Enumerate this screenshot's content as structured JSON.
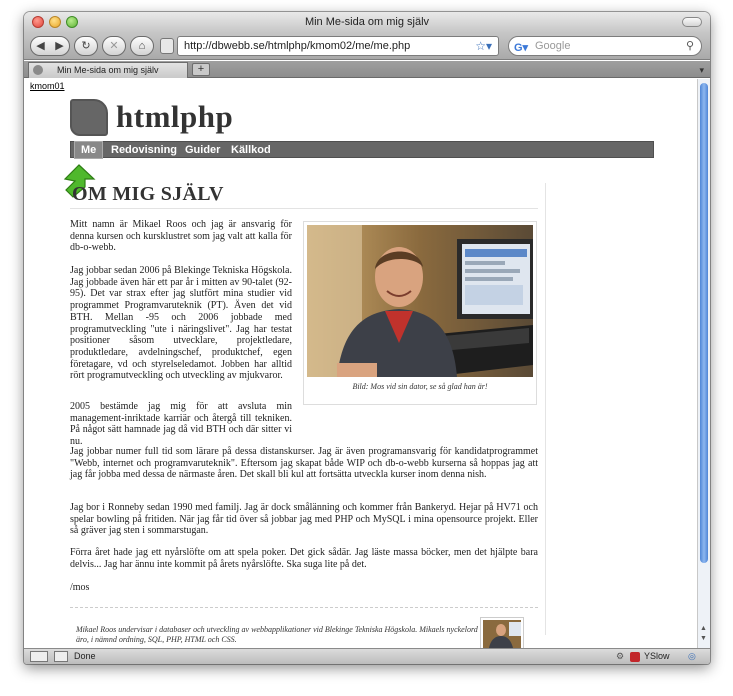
{
  "browser": {
    "window_title": "Min Me-sida om mig själv",
    "url": "http://dbwebb.se/htmlphp/kmom02/me/me.php",
    "search_placeholder": "Google",
    "tab_label": "Min Me-sida om mig själv",
    "new_tab_label": "+",
    "status_text": "Done",
    "yslow_label": "YSlow"
  },
  "page": {
    "kmom_link": "kmom01",
    "site_title": "htmlphp",
    "nav": [
      {
        "label": "Me",
        "selected": true
      },
      {
        "label": "Redovisning",
        "selected": false
      },
      {
        "label": "Guider",
        "selected": false
      },
      {
        "label": "Källkod",
        "selected": false
      }
    ],
    "heading": "OM MIG SJÄLV",
    "paragraphs": [
      "Mitt namn är Mikael Roos och jag är ansvarig för denna kursen och kursklustret som jag valt att kalla för db-o-webb.",
      "Jag jobbar sedan 2006 på Blekinge Tekniska Högskola. Jag jobbade även här ett par år i mitten av 90-talet (92-95). Det var strax efter jag slutfört mina studier vid programmet Programvaruteknik (PT). Även det vid BTH. Mellan -95 och 2006 jobbade med programutveckling \"ute i näringslivet\". Jag har testat positioner såsom utvecklare, projektledare, produktledare, avdelningschef, produktchef, egen företagare, vd och styrelseledamot. Jobben har alltid rört programutveckling och utveckling av mjukvaror.",
      "2005 bestämde jag mig för att avsluta min management-inriktade karriär och återgå till tekniken. På något sätt hamnade jag då vid BTH och där sitter vi nu.",
      "Jag jobbar numer full tid som lärare på dessa distanskurser. Jag är även programansvarig för kandidatprogrammet \"Webb, internet och programvaruteknik\". Eftersom jag skapat både WIP och db-o-webb kurserna så hoppas jag att jag får jobba med dessa de närmaste åren. Det skall bli kul att fortsätta utveckla kurser inom denna nish.",
      "Jag bor i Ronneby sedan 1990 med familj. Jag är dock smålänning och kommer från Bankeryd. Hejar på HV71 och spelar bowling på fritiden. När jag får tid över så jobbar jag med PHP och MySQL i mina opensource projekt. Eller så gräver jag sten i sommarstugan.",
      "Förra året hade jag ett nyårslöfte om att spela poker. Det gick sådär. Jag läste massa böcker, men det hjälpte bara delvis... Jag har ännu inte kommit på årets nyårslöfte. Ska suga lite på det.",
      "/mos"
    ],
    "photo_caption": "Bild: Mos vid sin dator, se så glad han är!",
    "footer": "Mikael Roos undervisar i databaser och utveckling av webbapplikationer vid Blekinge Tekniska Högskola. Mikaels nyckelord äro, i nämnd ordning, SQL, PHP, HTML och CSS."
  },
  "colors": {
    "nav_bg": "#666666",
    "nav_selected": "#888888",
    "arrow_green": "#4fb82c",
    "scroll_thumb": "#5b8fdb"
  }
}
